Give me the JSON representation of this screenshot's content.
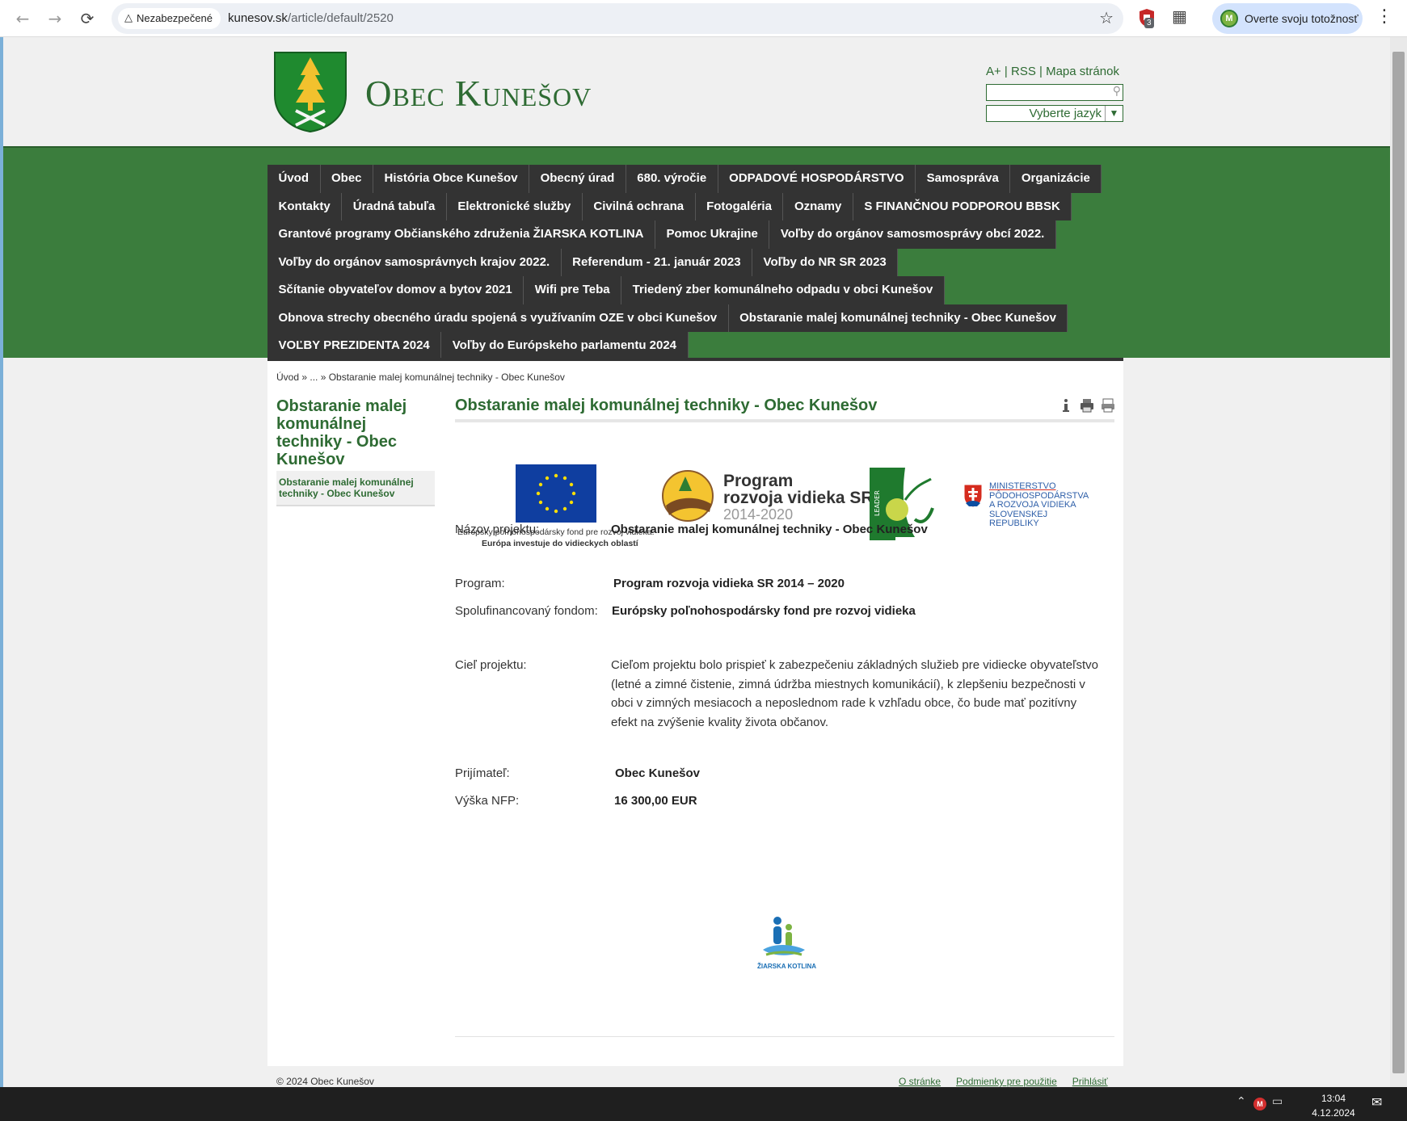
{
  "browser": {
    "security_label": "Nezabezpečené",
    "url_host": "kunesov.sk",
    "url_path": "/article/default/2520",
    "extension_badge": "3",
    "profile_initial": "M",
    "profile_label": "Overte svoju totožnosť"
  },
  "header": {
    "site_title": "Obec Kunešov",
    "links": [
      "A+",
      "RSS",
      "Mapa stránok"
    ],
    "search_placeholder": "",
    "language_label": "Vyberte jazyk"
  },
  "menu": {
    "rows": [
      [
        "Úvod",
        "Obec",
        "História Obce Kunešov",
        "Obecný úrad",
        "680. výročie",
        "ODPADOVÉ HOSPODÁRSTVO",
        "Samospráva",
        "Organizácie"
      ],
      [
        "Kontakty",
        "Úradná tabuľa",
        "Elektronické služby",
        "Civilná ochrana",
        "Fotogaléria",
        "Oznamy",
        "S FINANČNOU PODPOROU BBSK"
      ],
      [
        "Grantové programy Občianského združenia ŽIARSKA KOTLINA",
        "Pomoc Ukrajine",
        "Voľby do orgánov samosmosprávy obcí 2022."
      ],
      [
        "Voľby do orgánov samosprávnych krajov 2022.",
        "Referendum - 21. január 2023",
        "Voľby do NR SR 2023"
      ],
      [
        "Sčítanie obyvateľov domov a bytov 2021",
        "Wifi pre Teba",
        "Triedený zber komunálneho odpadu v obci Kunešov"
      ],
      [
        "Obnova strechy obecného úradu spojená s využívaním OZE v obci Kunešov",
        "Obstaranie malej komunálnej techniky - Obec Kunešov"
      ],
      [
        "VOĽBY PREZIDENTA 2024",
        "Voľby do Európskeho parlamentu 2024"
      ]
    ]
  },
  "breadcrumb": {
    "home": "Úvod",
    "sep1": " » ",
    "ellipsis": "...",
    "sep2": " » ",
    "current": "Obstaranie malej komunálnej techniky - Obec Kunešov"
  },
  "sidebar": {
    "title": "Obstaranie malej komunálnej techniky - Obec Kunešov",
    "item": "Obstaranie malej komunálnej techniky - Obec Kunešov"
  },
  "article": {
    "title": "Obstaranie malej komunálnej techniky - Obec Kunešov",
    "logos": {
      "eu_caption_line1": "Európsky poľnohospodársky fond pre rozvoj vidieka:",
      "eu_caption_line2": "Európa investuje do vidieckych oblastí",
      "prv_line1": "Program",
      "prv_line2": "rozvoja vidieka SR",
      "prv_years": "2014-2020",
      "leader_label": "LEADER",
      "ministry_line1": "MINISTERSTVO",
      "ministry_line2": "PÔDOHOSPODÁRSTVA",
      "ministry_line3": "A ROZVOJA VIDIEKA",
      "ministry_line4": "SLOVENSKEJ REPUBLIKY",
      "kotlina_label": "ŽIARSKA KOTLINA"
    },
    "fields": {
      "project_name_label": "Názov projektu:",
      "project_name_value": "Obstaranie malej komunálnej techniky -  Obec Kunešov",
      "program_label": "Program:",
      "program_value": "Program rozvoja vidieka SR 2014 – 2020",
      "fund_label": "Spolufinancovaný fondom:",
      "fund_value": "Európsky poľnohospodársky fond pre rozvoj vidieka",
      "goal_label": "Cieľ projektu:",
      "goal_value": "Cieľom projektu bolo prispieť k zabezpečeniu základných služieb pre vidiecke obyvateľstvo (letné a zimné čistenie, zimná údržba miestnych komunikácií), k zlepšeniu bezpečnosti v obci v zimných mesiacoch a neposlednom rade k vzhľadu obce, čo bude mať pozitívny efekt na zvýšenie kvality života občanov.",
      "recipient_label": "Prijímateľ:",
      "recipient_value": "Obec Kunešov",
      "nfp_label": "Výška NFP:",
      "nfp_value": "16 300,00 EUR"
    }
  },
  "footer": {
    "copyright": "© 2024 Obec Kunešov",
    "links": [
      "O stránke",
      "Podmienky pre použitie",
      "Prihlásiť"
    ]
  },
  "taskbar": {
    "time": "13:04",
    "date": "4.12.2024"
  },
  "colors": {
    "brand_green": "#2e6b33",
    "band_green": "#3b7d3d",
    "menu_dark": "#333333"
  }
}
